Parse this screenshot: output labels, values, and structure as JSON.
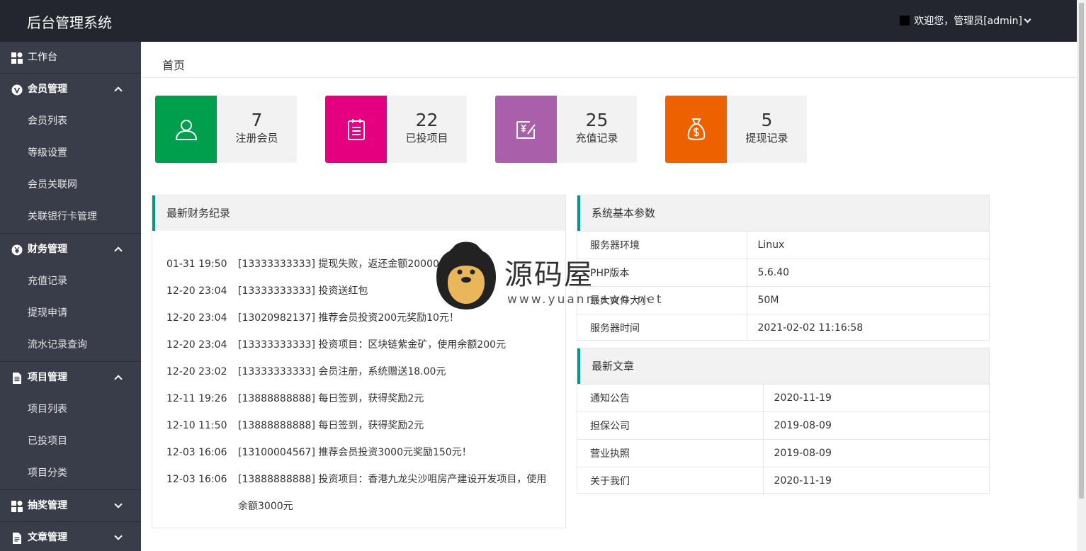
{
  "header": {
    "title": "后台管理系统",
    "user_label": "欢迎您，管理员[admin]"
  },
  "sidebar": {
    "workbench": "工作台",
    "groups": [
      {
        "label": "会员管理",
        "expanded": true,
        "items": [
          "会员列表",
          "等级设置",
          "会员关联网",
          "关联银行卡管理"
        ]
      },
      {
        "label": "财务管理",
        "expanded": true,
        "items": [
          "充值记录",
          "提现申请",
          "流水记录查询"
        ]
      },
      {
        "label": "项目管理",
        "expanded": true,
        "items": [
          "项目列表",
          "已投项目",
          "项目分类"
        ]
      },
      {
        "label": "抽奖管理",
        "expanded": false,
        "items": []
      },
      {
        "label": "文章管理",
        "expanded": false,
        "items": []
      }
    ]
  },
  "breadcrumb": "首页",
  "stats": [
    {
      "value": "7",
      "label": "注册会员",
      "color": "#009f4d",
      "icon": "user-icon"
    },
    {
      "value": "22",
      "label": "已投项目",
      "color": "#e4007f",
      "icon": "list-icon"
    },
    {
      "value": "25",
      "label": "充值记录",
      "color": "#a95fa9",
      "icon": "recharge-icon"
    },
    {
      "value": "5",
      "label": "提现记录",
      "color": "#ee6100",
      "icon": "money-bag-icon"
    }
  ],
  "finance": {
    "title": "最新财务纪录",
    "rows": [
      {
        "time": "01-31 19:50",
        "text": "[13333333333] 提现失败，返还金额200000.00元"
      },
      {
        "time": "12-20 23:04",
        "text": "[13333333333] 投资送红包"
      },
      {
        "time": "12-20 23:04",
        "text": "[13020982137] 推荐会员投资200元奖励10元！"
      },
      {
        "time": "12-20 23:04",
        "text": "[13333333333] 投资项目：区块链紫金矿，使用余额200元"
      },
      {
        "time": "12-20 23:02",
        "text": "[13333333333] 会员注册，系统赠送18.00元"
      },
      {
        "time": "12-11 19:26",
        "text": "[13888888888] 每日签到，获得奖励2元"
      },
      {
        "time": "12-10 11:50",
        "text": "[13888888888] 每日签到，获得奖励2元"
      },
      {
        "time": "12-03 16:06",
        "text": "[13100004567] 推荐会员投资3000元奖励150元！"
      },
      {
        "time": "12-03 16:06",
        "text": "[13888888888] 投资项目：香港九龙尖沙咀房产建设开发项目，使用余额3000元"
      }
    ]
  },
  "system": {
    "title": "系统基本参数",
    "rows": [
      {
        "key": "服务器环境",
        "value": "Linux"
      },
      {
        "key": "PHP版本",
        "value": "5.6.40"
      },
      {
        "key": "最大文件大小",
        "value": "50M"
      },
      {
        "key": "服务器时间",
        "value": "2021-02-02 11:16:58"
      }
    ]
  },
  "articles": {
    "title": "最新文章",
    "rows": [
      {
        "name": "通知公告",
        "date": "2020-11-19"
      },
      {
        "name": "担保公司",
        "date": "2019-08-09"
      },
      {
        "name": "营业执照",
        "date": "2019-08-09"
      },
      {
        "name": "关于我们",
        "date": "2020-11-19"
      }
    ]
  },
  "watermark": {
    "brand": "源码屋",
    "url": "www.yuanmawu.net"
  }
}
